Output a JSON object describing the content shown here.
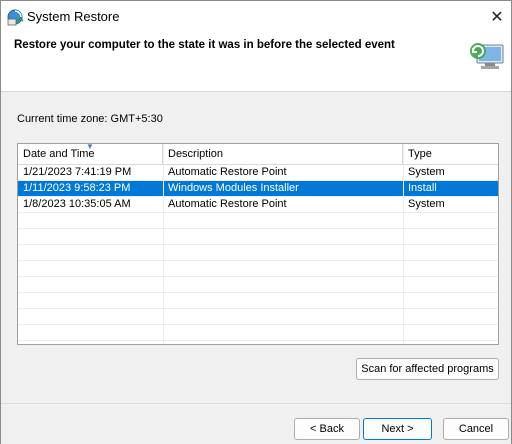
{
  "window": {
    "title": "System Restore",
    "close_glyph": "✕"
  },
  "header": {
    "title": "Restore your computer to the state it was in before the selected event"
  },
  "timezone_label": "Current time zone: GMT+5:30",
  "table": {
    "columns": [
      "Date and Time",
      "Description",
      "Type"
    ],
    "rows": [
      {
        "date": "1/21/2023 7:41:19 PM",
        "description": "Automatic Restore Point",
        "type": "System",
        "selected": false
      },
      {
        "date": "1/11/2023 9:58:23 PM",
        "description": "Windows Modules Installer",
        "type": "Install",
        "selected": true
      },
      {
        "date": "1/8/2023 10:35:05 AM",
        "description": "Automatic Restore Point",
        "type": "System",
        "selected": false
      }
    ]
  },
  "buttons": {
    "scan": "Scan for affected programs",
    "back": "< Back",
    "next": "Next >",
    "cancel": "Cancel"
  },
  "colors": {
    "selection": "#0078d7"
  },
  "icons": [
    "system-restore-icon",
    "close-icon",
    "sort-ascending-icon",
    "restore-computer-icon"
  ]
}
